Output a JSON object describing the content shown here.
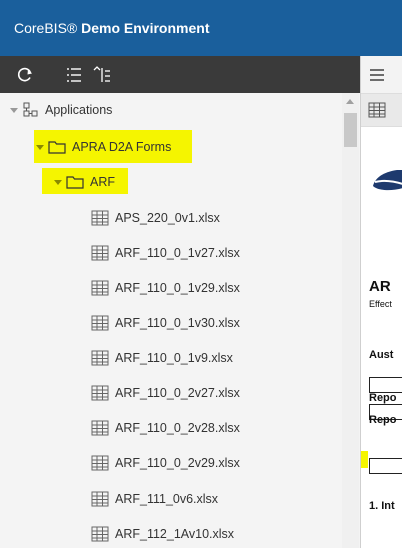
{
  "app": {
    "brand_prefix": "CoreBIS®",
    "brand_title": "Demo Environment"
  },
  "colors": {
    "titlebar": "#1a5f9c",
    "toolbar": "#3a3a3a",
    "highlight": "#f5f500",
    "folder_stroke": "#333333"
  },
  "toolbar": {
    "icons": [
      "refresh-icon",
      "expand-all-icon",
      "collapse-all-icon"
    ]
  },
  "tree": {
    "root": {
      "label": "Applications",
      "icon": "hierarchy-icon",
      "expanded": true
    },
    "folder1": {
      "label": "APRA D2A Forms",
      "icon": "folder-icon",
      "expanded": true,
      "highlighted": true
    },
    "folder2": {
      "label": "ARF",
      "icon": "folder-icon",
      "expanded": true,
      "highlighted": true
    },
    "files": [
      {
        "label": "APS_220_0v1.xlsx"
      },
      {
        "label": "ARF_110_0_1v27.xlsx"
      },
      {
        "label": "ARF_110_0_1v29.xlsx"
      },
      {
        "label": "ARF_110_0_1v30.xlsx"
      },
      {
        "label": "ARF_110_0_1v9.xlsx"
      },
      {
        "label": "ARF_110_0_2v27.xlsx"
      },
      {
        "label": "ARF_110_0_2v28.xlsx"
      },
      {
        "label": "ARF_110_0_2v29.xlsx"
      },
      {
        "label": "ARF_111_0v6.xlsx"
      },
      {
        "label": "ARF_112_1Av10.xlsx"
      }
    ]
  },
  "doc_preview": {
    "heading": "AR",
    "subtext": "Effect",
    "aust": "Aust",
    "repo1": "Repo",
    "repo2": "Repo",
    "section": "1. Int"
  }
}
